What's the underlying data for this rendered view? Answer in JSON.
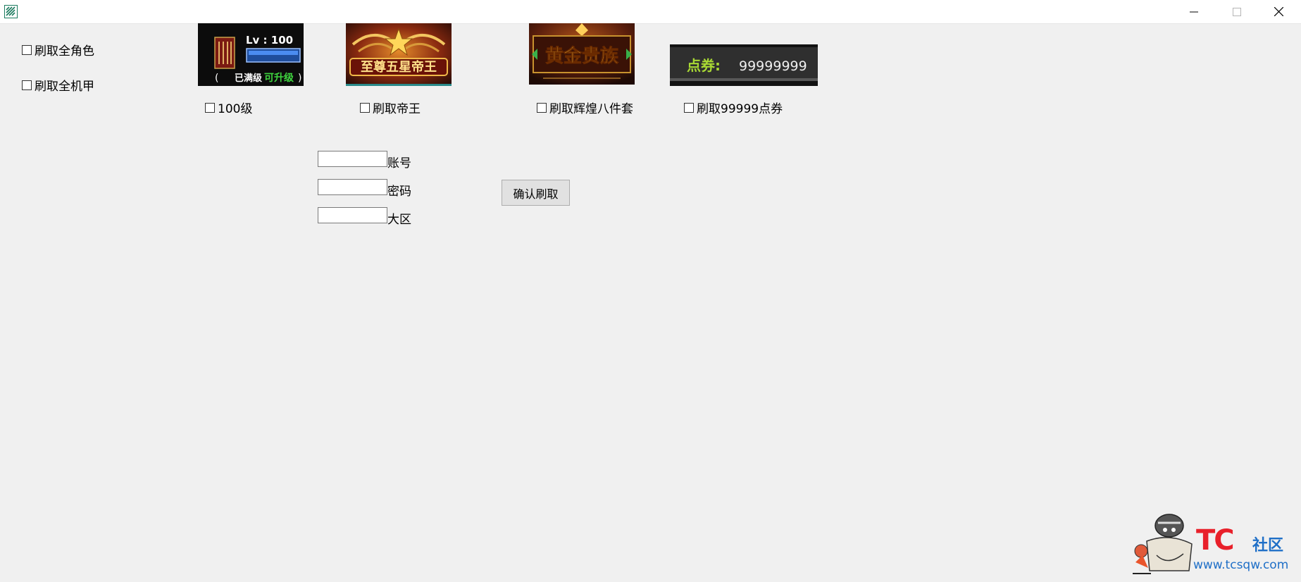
{
  "window": {
    "icon": "app-icon",
    "controls": {
      "minimize": "minimize-icon",
      "maximize": "maximize-icon",
      "close": "close-icon"
    }
  },
  "left_options": [
    {
      "label": "刷取全角色",
      "checked": false
    },
    {
      "label": "刷取全机甲",
      "checked": false
    }
  ],
  "banners": {
    "level": {
      "lv_text": "Lv : 100",
      "bottom_left": "已满级",
      "bottom_right": "可升级"
    },
    "emperor": {
      "text": "至尊五星帝王"
    },
    "gold": {
      "text": "黄金贵族"
    },
    "coupon": {
      "label": "点券:",
      "value": "99999999"
    }
  },
  "banner_options": [
    {
      "label": "100级",
      "checked": false
    },
    {
      "label": "刷取帝王",
      "checked": false
    },
    {
      "label": "刷取辉煌八件套",
      "checked": false
    },
    {
      "label": "刷取99999点券",
      "checked": false
    }
  ],
  "form": {
    "account": {
      "label": "账号",
      "value": ""
    },
    "password": {
      "label": "密码",
      "value": ""
    },
    "region": {
      "label": "大区",
      "value": ""
    },
    "submit_label": "确认刷取"
  },
  "watermark": {
    "logo": "TC",
    "suffix": "社区",
    "url": "www.tcsqw.com"
  },
  "colors": {
    "background": "#f0f0f0",
    "titlebar": "#ffffff",
    "button": "#e1e1e1",
    "watermark_red": "#e8202a",
    "watermark_blue": "#1f6fc7"
  }
}
